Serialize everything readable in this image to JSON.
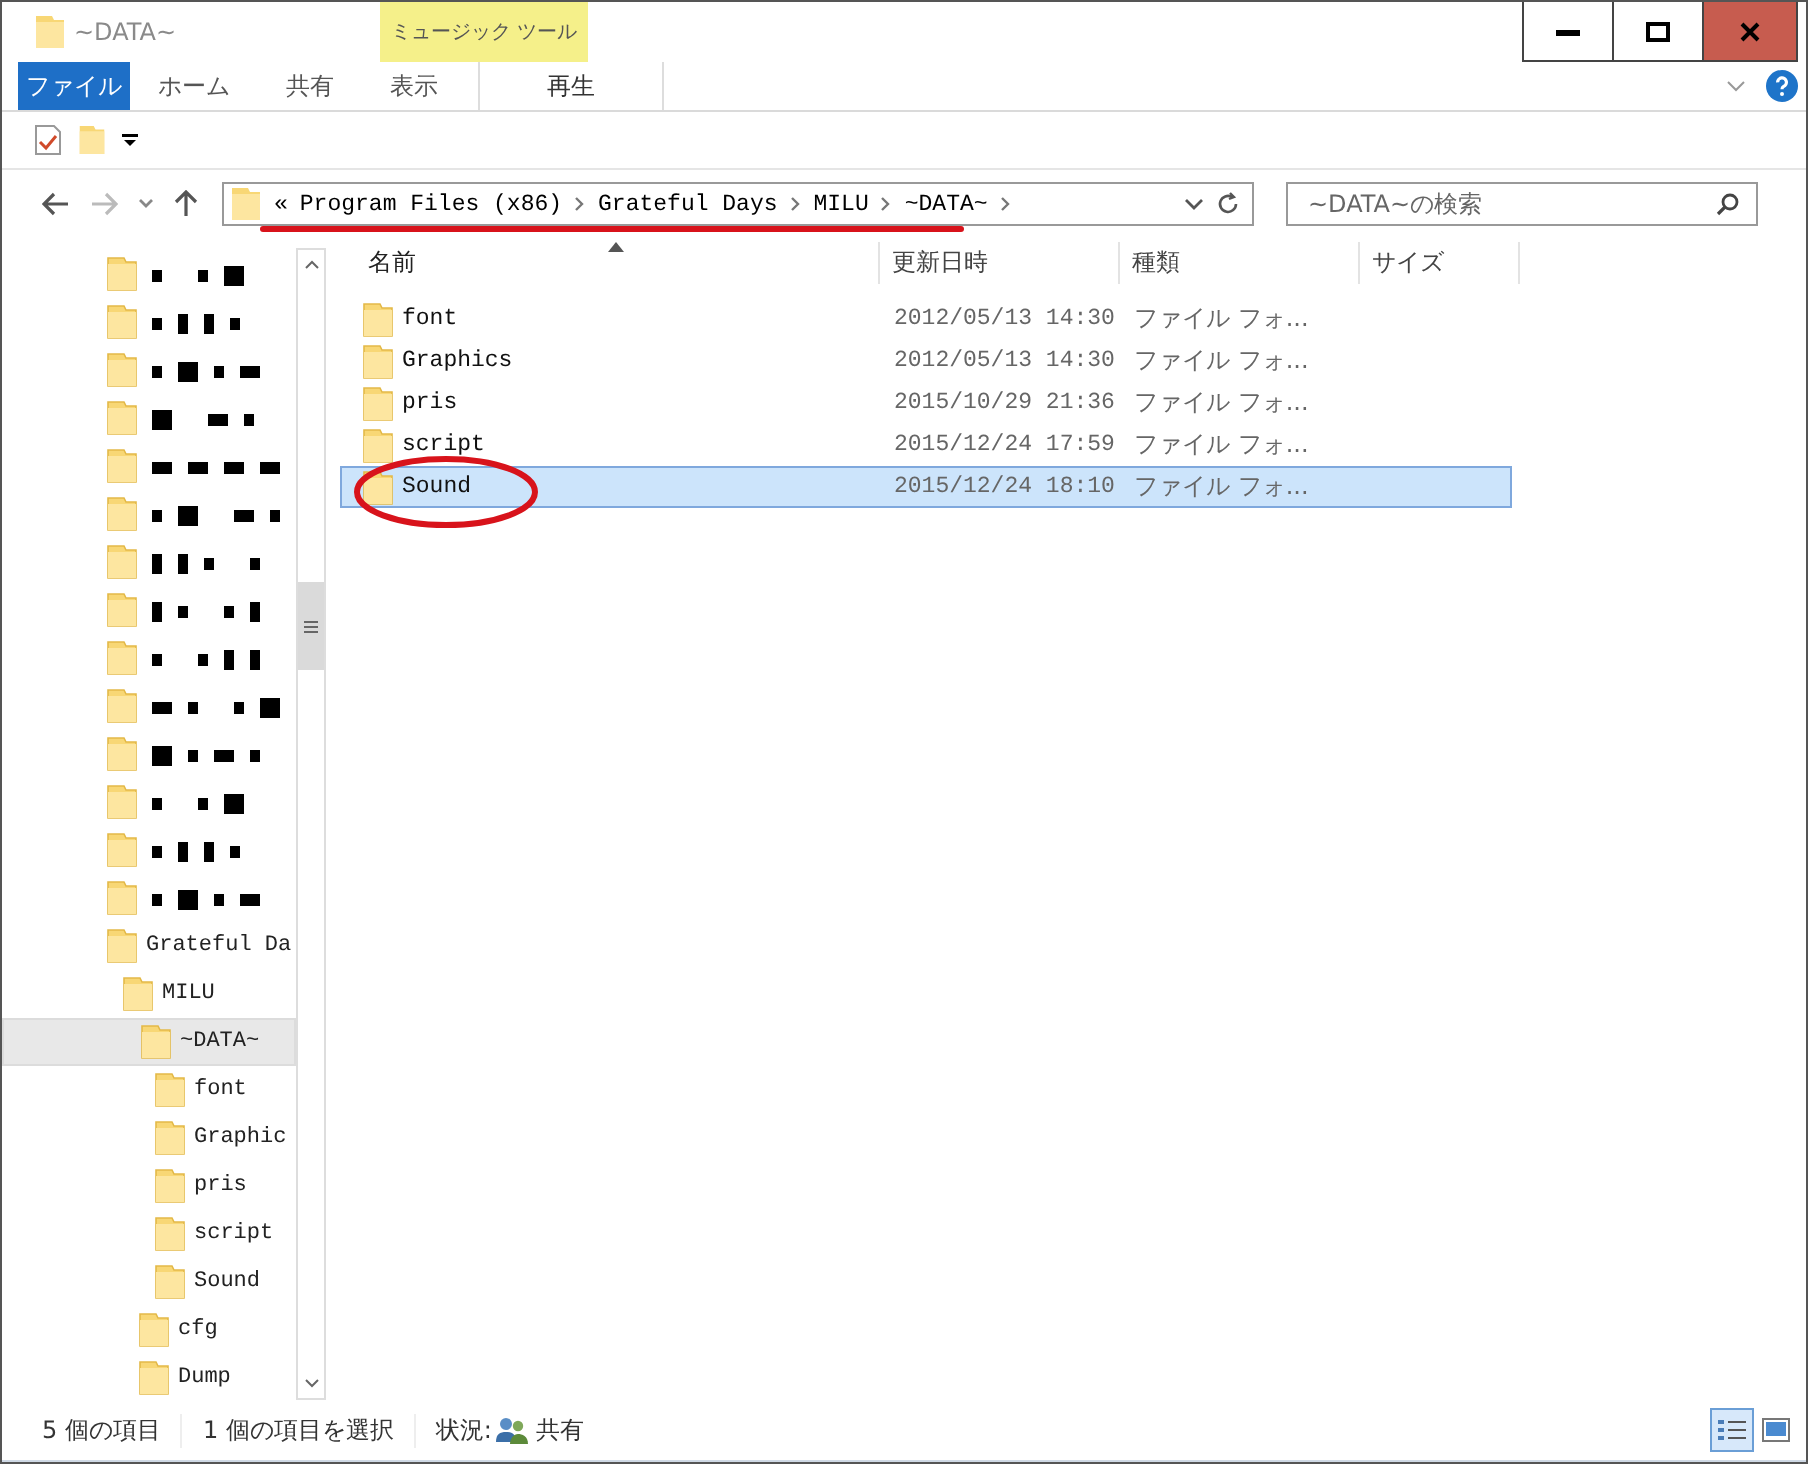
{
  "window": {
    "title": "~DATA~"
  },
  "ribbon": {
    "contextual_group": "ミュージック ツール",
    "tabs": [
      {
        "label": "ファイル",
        "kind": "file"
      },
      {
        "label": "ホーム",
        "kind": "plain"
      },
      {
        "label": "共有",
        "kind": "plain"
      },
      {
        "label": "表示",
        "kind": "plain"
      },
      {
        "label": "再生",
        "kind": "contextual"
      }
    ]
  },
  "address_bar": {
    "overflow": "«",
    "segments": [
      "Program Files (x86)",
      "Grateful Days",
      "MILU",
      "~DATA~"
    ]
  },
  "search": {
    "placeholder": "~DATA~の検索"
  },
  "tree": {
    "items": [
      {
        "kind": "redacted"
      },
      {
        "kind": "redacted"
      },
      {
        "kind": "redacted"
      },
      {
        "kind": "redacted"
      },
      {
        "kind": "redacted"
      },
      {
        "kind": "redacted"
      },
      {
        "kind": "redacted"
      },
      {
        "kind": "redacted"
      },
      {
        "kind": "redacted"
      },
      {
        "kind": "redacted"
      },
      {
        "kind": "redacted"
      },
      {
        "kind": "redacted"
      },
      {
        "kind": "redacted"
      },
      {
        "kind": "redacted"
      },
      {
        "kind": "folder",
        "label": "Grateful Da",
        "selected": false,
        "children": [
          {
            "kind": "folder",
            "label": "MILU",
            "selected": false,
            "children": [
              {
                "kind": "folder",
                "label": "~DATA~",
                "selected": true,
                "children": [
                  {
                    "kind": "folder",
                    "label": "font",
                    "selected": false
                  },
                  {
                    "kind": "folder",
                    "label": "Graphic",
                    "selected": false
                  },
                  {
                    "kind": "folder",
                    "label": "pris",
                    "selected": false
                  },
                  {
                    "kind": "folder",
                    "label": "script",
                    "selected": false
                  },
                  {
                    "kind": "folder",
                    "label": "Sound",
                    "selected": false
                  }
                ]
              },
              {
                "kind": "folder",
                "label": "cfg",
                "selected": false
              },
              {
                "kind": "folder",
                "label": "Dump",
                "selected": false
              }
            ]
          }
        ]
      }
    ]
  },
  "file_list": {
    "columns": [
      {
        "label": "名前",
        "sorted": true
      },
      {
        "label": "更新日時",
        "sorted": false
      },
      {
        "label": "種類",
        "sorted": false
      },
      {
        "label": "サイズ",
        "sorted": false
      }
    ],
    "rows": [
      {
        "name": "font",
        "modified": "2012/05/13 14:30",
        "type": "ファイル フォ...",
        "selected": false
      },
      {
        "name": "Graphics",
        "modified": "2012/05/13 14:30",
        "type": "ファイル フォ...",
        "selected": false
      },
      {
        "name": "pris",
        "modified": "2015/10/29 21:36",
        "type": "ファイル フォ...",
        "selected": false
      },
      {
        "name": "script",
        "modified": "2015/12/24 17:59",
        "type": "ファイル フォ...",
        "selected": false
      },
      {
        "name": "Sound",
        "modified": "2015/12/24 18:10",
        "type": "ファイル フォ...",
        "selected": true
      }
    ]
  },
  "annotations": {
    "address_underline": true,
    "selected_row_circle": true
  },
  "status_bar": {
    "item_count": "5 個の項目",
    "selection": "1 個の項目を選択",
    "state_label": "状況:",
    "state_value": "共有",
    "view_modes": [
      {
        "kind": "details",
        "selected": true
      },
      {
        "kind": "large_icons",
        "selected": false
      }
    ]
  }
}
